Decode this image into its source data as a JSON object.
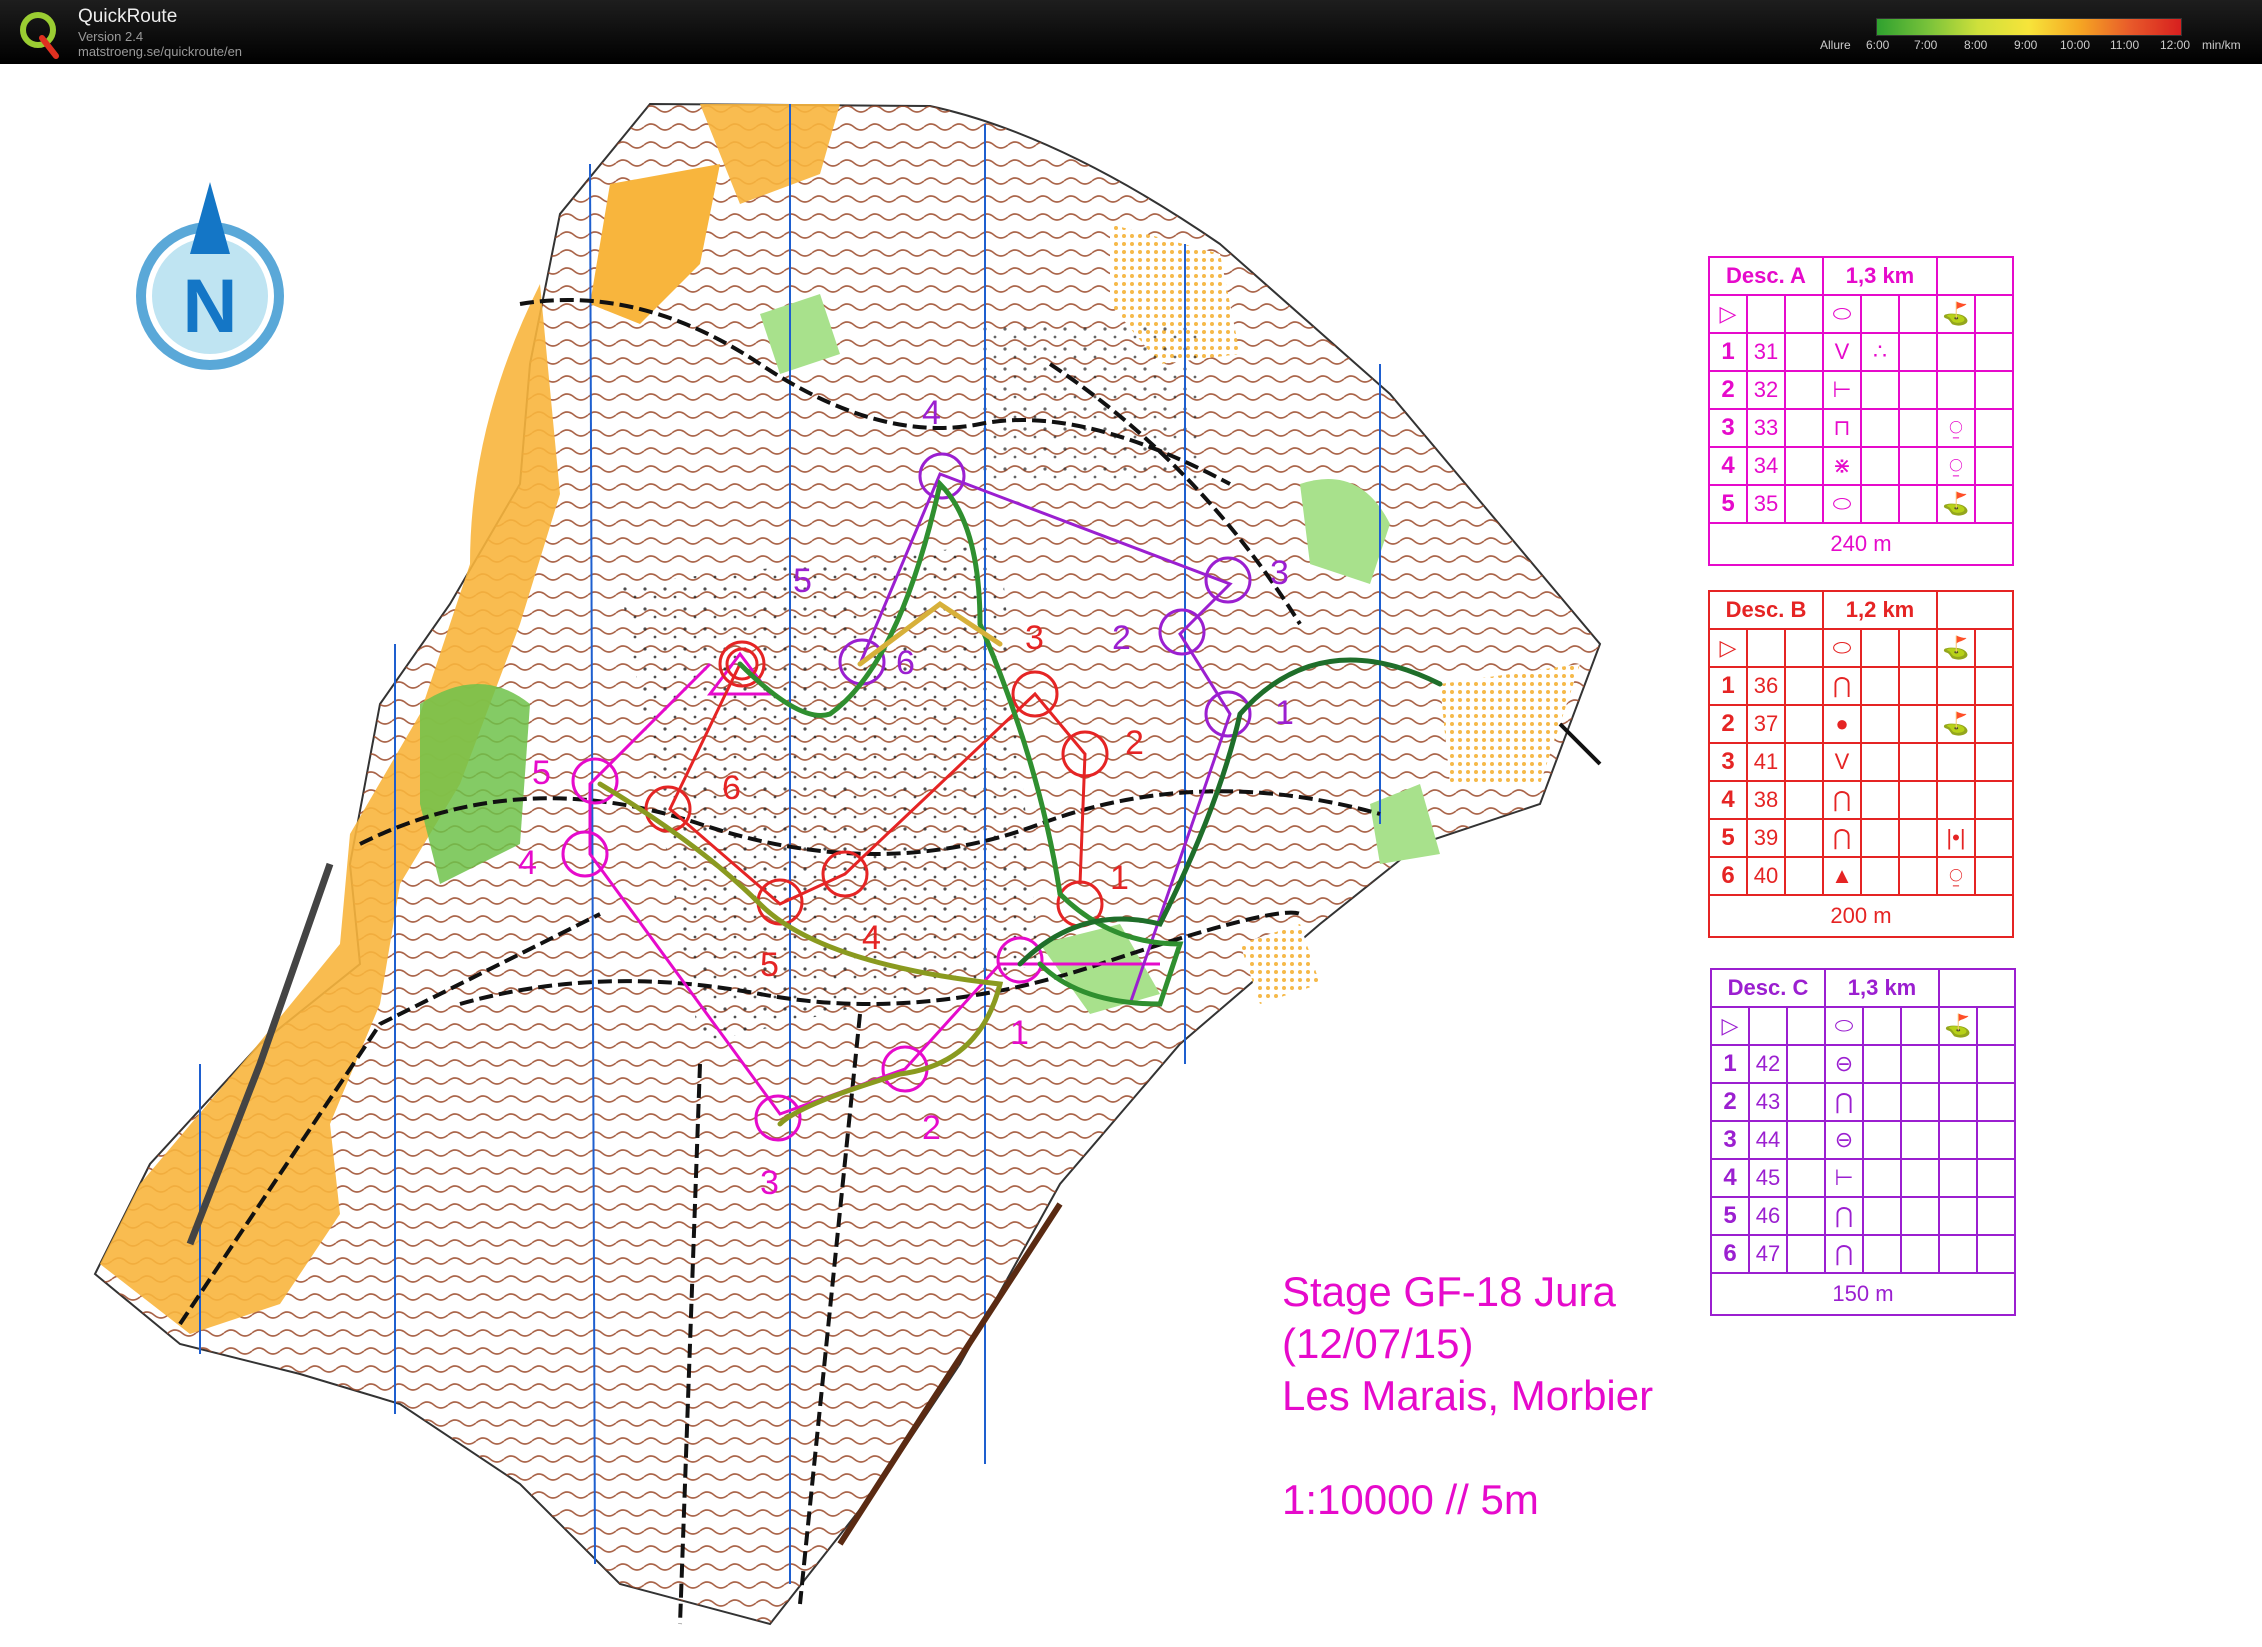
{
  "app": {
    "name": "QuickRoute",
    "version": "Version 2.4",
    "url": "matstroeng.se/quickroute/en"
  },
  "pace_scale": {
    "label": "Allure",
    "ticks": [
      "6:00",
      "7:00",
      "8:00",
      "9:00",
      "10:00",
      "11:00",
      "12:00"
    ],
    "unit": "min/km",
    "colors": [
      "#2fa12f",
      "#78c23a",
      "#cfe03b",
      "#f7e43a",
      "#f5a623",
      "#e85a2a",
      "#d71f1f"
    ]
  },
  "map": {
    "title_lines": [
      "Stage GF-18 Jura",
      "(12/07/15)",
      "Les Marais, Morbier"
    ],
    "scale": "1:10000 // 5m",
    "north_label": "N",
    "course_a_labels": [
      "1",
      "2",
      "3",
      "4",
      "5"
    ],
    "course_b_labels": [
      "1",
      "2",
      "3",
      "4",
      "5",
      "6"
    ],
    "course_c_labels": [
      "1",
      "2",
      "3",
      "4",
      "5",
      "6"
    ]
  },
  "descriptions": [
    {
      "name": "Desc. A",
      "length": "1,3 km",
      "color": "#e60acb",
      "finish": "240 m",
      "rows": [
        [
          "1",
          "31"
        ],
        [
          "2",
          "32"
        ],
        [
          "3",
          "33"
        ],
        [
          "4",
          "34"
        ],
        [
          "5",
          "35"
        ]
      ]
    },
    {
      "name": "Desc. B",
      "length": "1,2 km",
      "color": "#e52424",
      "finish": "200 m",
      "rows": [
        [
          "1",
          "36"
        ],
        [
          "2",
          "37"
        ],
        [
          "3",
          "41"
        ],
        [
          "4",
          "38"
        ],
        [
          "5",
          "39"
        ],
        [
          "6",
          "40"
        ]
      ]
    },
    {
      "name": "Desc. C",
      "length": "1,3 km",
      "color": "#9b1fd0",
      "finish": "150 m",
      "rows": [
        [
          "1",
          "42"
        ],
        [
          "2",
          "43"
        ],
        [
          "3",
          "44"
        ],
        [
          "4",
          "45"
        ],
        [
          "5",
          "46"
        ],
        [
          "6",
          "47"
        ]
      ]
    }
  ]
}
